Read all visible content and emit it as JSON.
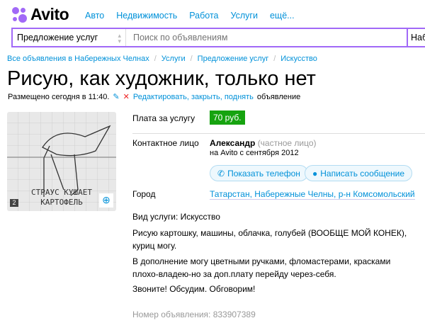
{
  "header": {
    "logo": "Avito",
    "nav": [
      "Авто",
      "Недвижимость",
      "Работа",
      "Услуги",
      "ещё..."
    ]
  },
  "search": {
    "category": "Предложение услуг",
    "placeholder": "Поиск по объявлениям",
    "location": "Наб"
  },
  "breadcrumbs": [
    "Все объявления в Набережных Челнах",
    "Услуги",
    "Предложение услуг",
    "Искусство"
  ],
  "title": "Рисую, как художник, только нет",
  "posted": {
    "text": "Размещено сегодня в 11:40.",
    "edit_link": "Редактировать, закрыть, поднять",
    "suffix": "объявление"
  },
  "photo": {
    "count": "2",
    "caption_line1": "СТРАУС КУШАЕТ",
    "caption_line2": "КАРТОФЕЛЬ"
  },
  "details": {
    "price_label": "Плата за услугу",
    "price": "70 руб.",
    "contact_label": "Контактное лицо",
    "contact_name": "Александр",
    "contact_type": "(частное лицо)",
    "since": "на Avito с сентября 2012",
    "show_phone": "Показать телефон",
    "write_message": "Написать сообщение",
    "city_label": "Город",
    "city": "Татарстан, Набережные Челны, р-н Комсомольский"
  },
  "description": {
    "service_type": "Вид услуги: Искусство",
    "p1": "Рисую картошку, машины, облачка, голубей (ВООБЩЕ МОЙ КОНЕК), куриц могу.",
    "p2": "В дополнение могу цветными ручками, фломастерами, красками плохо-владею-но за доп.плату перейду через-себя.",
    "p3": "Звоните! Обсудим. Обговорим!"
  },
  "ad_number": "Номер объявления: 833907389",
  "colors": {
    "accent": "#a169f7",
    "link": "#0091d9",
    "price": "#16a30f"
  }
}
